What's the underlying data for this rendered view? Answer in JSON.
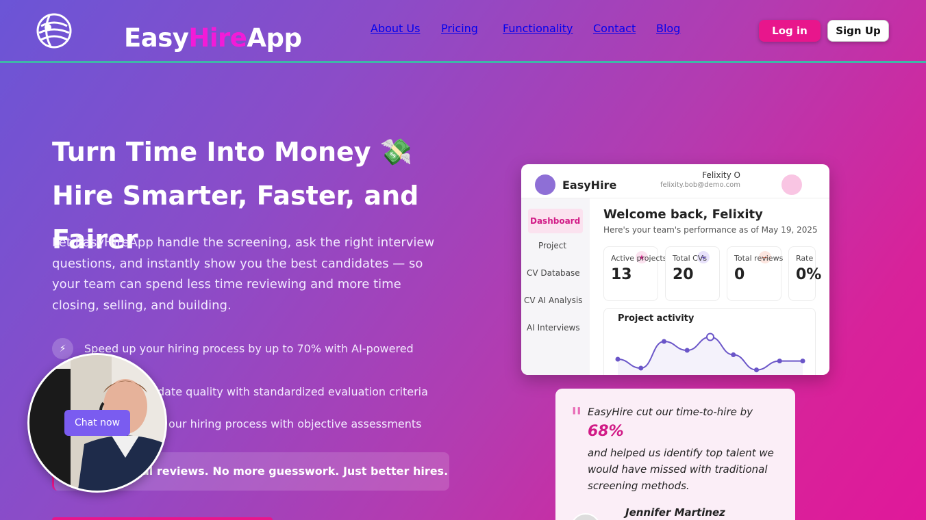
{
  "header": {
    "brand_prefix": "Easy",
    "brand_highlight": "Hire",
    "brand_suffix": "App",
    "nav": [
      "About Us",
      "Pricing",
      "Functionality",
      "Contact",
      "Blog"
    ],
    "login_label": "Log in",
    "signup_label": "Sign Up"
  },
  "hero": {
    "title": "Turn Time Into Money 💸 Hire Smarter, Faster, and Fairer",
    "description": "Let EasyHireApp handle the screening, ask the right interview questions, and instantly show you the best candidates — so your team can spend less time reviewing and more time closing, selling, and building.",
    "features": [
      "Speed up your hiring process by up to 70% with AI-powered",
      "date quality with standardized evaluation criteria",
      "our hiring process with objective assessments"
    ],
    "banner": "al reviews. No more guesswork. Just better hires."
  },
  "chat": {
    "button_label": "Chat now"
  },
  "dashboard": {
    "brand": "EasyHire",
    "user_name": "Felixity O",
    "user_email": "felixity.bob@demo.com",
    "sidebar": [
      "Dashboard",
      "Project",
      "CV Database",
      "CV AI Analysis",
      "AI Interviews"
    ],
    "welcome": "Welcome back, Felixity",
    "subtitle": "Here's your team's performance as of May 19, 2025",
    "stats": [
      {
        "label": "Active projects",
        "value": "13"
      },
      {
        "label": "Total CVs",
        "value": "20"
      },
      {
        "label": "Total reviews",
        "value": "0"
      },
      {
        "label": "Rate",
        "value": "0%"
      }
    ],
    "chart_title": "Project activity",
    "chart_data": {
      "type": "line",
      "series": [
        {
          "values": [
            3,
            2,
            5,
            4,
            5.5,
            3.5,
            1.8,
            2.8,
            2.8
          ]
        }
      ]
    }
  },
  "testimonial": {
    "quote_mark": "\"",
    "text1": "EasyHire cut our time-to-hire by",
    "stat": "68%",
    "text2": "and helped us identify top talent we would have missed with traditional screening methods.",
    "author": "Jennifer Martinez"
  }
}
